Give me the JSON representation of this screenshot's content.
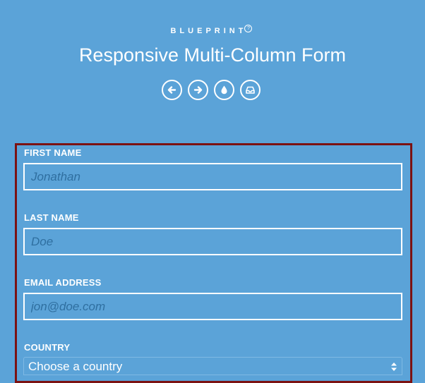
{
  "header": {
    "brand": "BLUEPRINT",
    "brand_mark": "?",
    "title": "Responsive Multi-Column Form",
    "nav_icons": [
      {
        "name": "previous-demo-icon",
        "glyph": "arrow-left"
      },
      {
        "name": "next-demo-icon",
        "glyph": "arrow-right"
      },
      {
        "name": "drop-icon",
        "glyph": "water-drop"
      },
      {
        "name": "inbox-icon",
        "glyph": "inbox-tray"
      }
    ]
  },
  "form": {
    "first_name": {
      "label": "FIRST NAME",
      "placeholder": "Jonathan"
    },
    "last_name": {
      "label": "LAST NAME",
      "placeholder": "Doe"
    },
    "email": {
      "label": "EMAIL ADDRESS",
      "placeholder": "jon@doe.com"
    },
    "country": {
      "label": "COUNTRY",
      "selected": "Choose a country"
    }
  },
  "colors": {
    "background": "#5ba3d8",
    "form_outline": "#7c1212",
    "placeholder_text": "#2f6fa0",
    "text": "#ffffff"
  }
}
